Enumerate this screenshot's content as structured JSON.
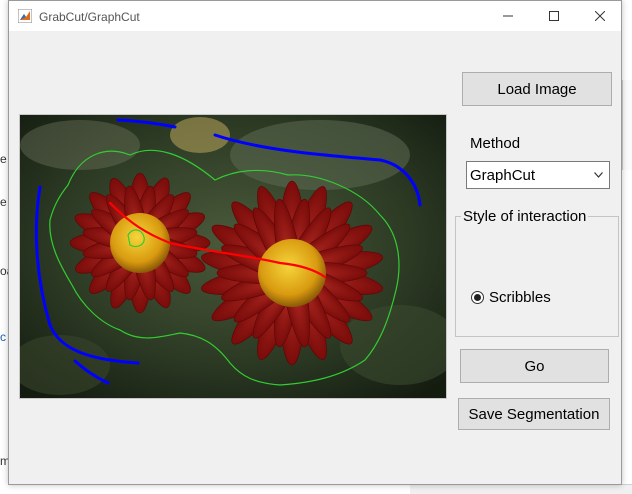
{
  "window": {
    "title": "GrabCut/GraphCut",
    "controls": [
      "minimize-icon",
      "maximize-icon",
      "close-icon"
    ]
  },
  "background_fragments": [
    "e",
    "e",
    "oa",
    "c",
    "m"
  ],
  "panel": {
    "load_button": "Load Image",
    "method_label": "Method",
    "method_selected": "GraphCut",
    "interaction_group_title": "Style of interaction",
    "interaction_option": "Scribbles",
    "go_button": "Go",
    "save_button": "Save Segmentation"
  },
  "colors": {
    "foreground_scribble": "#ff0000",
    "background_scribble": "#0000ff",
    "segmentation_outline": "#33cc33",
    "window_bg": "#f0f0f0",
    "button_bg": "#e1e1e1"
  }
}
